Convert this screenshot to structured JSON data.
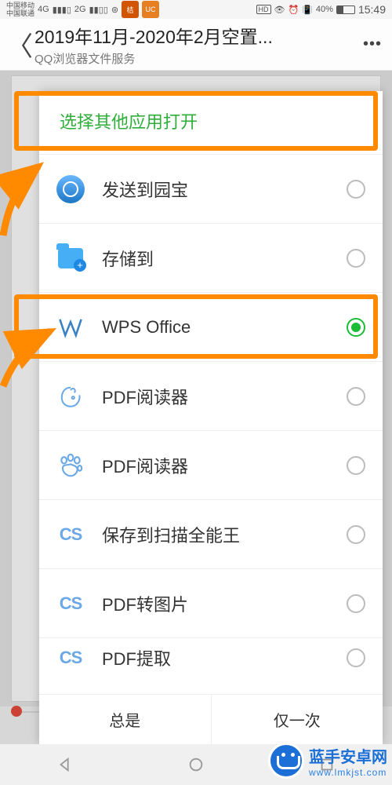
{
  "status_bar": {
    "carrier1": "中国移动",
    "carrier2": "中国联通",
    "net1": "4G",
    "net2": "2G",
    "hd": "HD",
    "battery_pct": "40%",
    "time": "15:49"
  },
  "header": {
    "title": "2019年11月-2020年2月空置...",
    "subtitle": "QQ浏览器文件服务",
    "back_glyph": "〈",
    "more_glyph": "•••"
  },
  "sheet": {
    "title": "选择其他应用打开",
    "items": [
      {
        "id": "yuanbao",
        "label": "发送到园宝",
        "selected": false,
        "icon": "circle"
      },
      {
        "id": "storage",
        "label": "存储到",
        "selected": false,
        "icon": "folder"
      },
      {
        "id": "wps",
        "label": "WPS Office",
        "selected": true,
        "icon": "wps"
      },
      {
        "id": "ucpdf",
        "label": "PDF阅读器",
        "selected": false,
        "icon": "uc"
      },
      {
        "id": "baidupdf",
        "label": "PDF阅读器",
        "selected": false,
        "icon": "baidu"
      },
      {
        "id": "camscan_save",
        "label": "保存到扫描全能王",
        "selected": false,
        "icon": "cs"
      },
      {
        "id": "camscan_img",
        "label": "PDF转图片",
        "selected": false,
        "icon": "cs"
      },
      {
        "id": "camscan_extract",
        "label": "PDF提取",
        "selected": false,
        "icon": "cs"
      }
    ],
    "footer": {
      "always": "总是",
      "once": "仅一次"
    }
  },
  "watermark": {
    "title": "蓝手安卓网",
    "url": "www.lmkjst.com"
  },
  "colors": {
    "accent_green": "#1abc36",
    "highlight": "#ff8a00"
  }
}
